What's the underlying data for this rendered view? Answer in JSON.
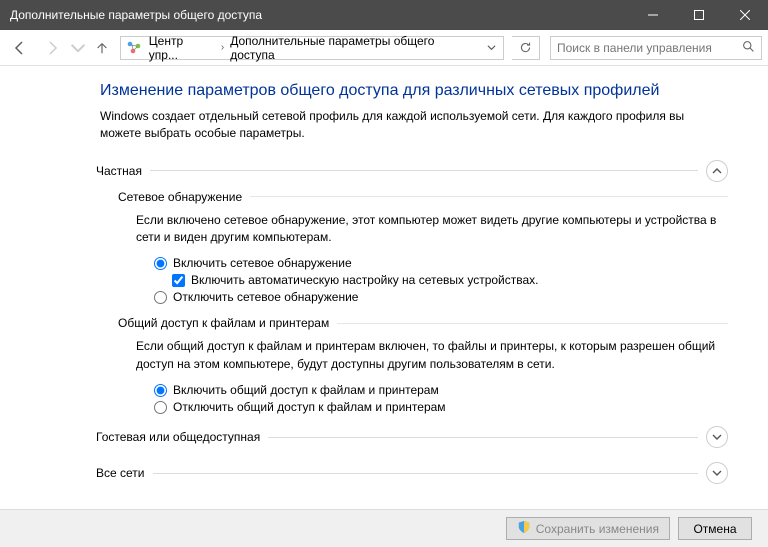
{
  "window": {
    "title": "Дополнительные параметры общего доступа"
  },
  "breadcrumb": {
    "item1": "Центр упр...",
    "item2": "Дополнительные параметры общего доступа"
  },
  "search": {
    "placeholder": "Поиск в панели управления"
  },
  "heading": "Изменение параметров общего доступа для различных сетевых профилей",
  "subtitle": "Windows создает отдельный сетевой профиль для каждой используемой сети. Для каждого профиля вы можете выбрать особые параметры.",
  "sections": {
    "private": {
      "label": "Частная",
      "discovery": {
        "label": "Сетевое обнаружение",
        "desc": "Если включено сетевое обнаружение, этот компьютер может видеть другие компьютеры и устройства в сети и виден другим компьютерам.",
        "opt_on": "Включить сетевое обнаружение",
        "opt_auto": "Включить автоматическую настройку на сетевых устройствах.",
        "opt_off": "Отключить сетевое обнаружение"
      },
      "sharing": {
        "label": "Общий доступ к файлам и принтерам",
        "desc": "Если общий доступ к файлам и принтерам включен, то файлы и принтеры, к которым разрешен общий доступ на этом компьютере, будут доступны другим пользователям в сети.",
        "opt_on": "Включить общий доступ к файлам и принтерам",
        "opt_off": "Отключить общий доступ к файлам и принтерам"
      }
    },
    "guest": {
      "label": "Гостевая или общедоступная"
    },
    "all": {
      "label": "Все сети"
    }
  },
  "footer": {
    "save": "Сохранить изменения",
    "cancel": "Отмена"
  }
}
